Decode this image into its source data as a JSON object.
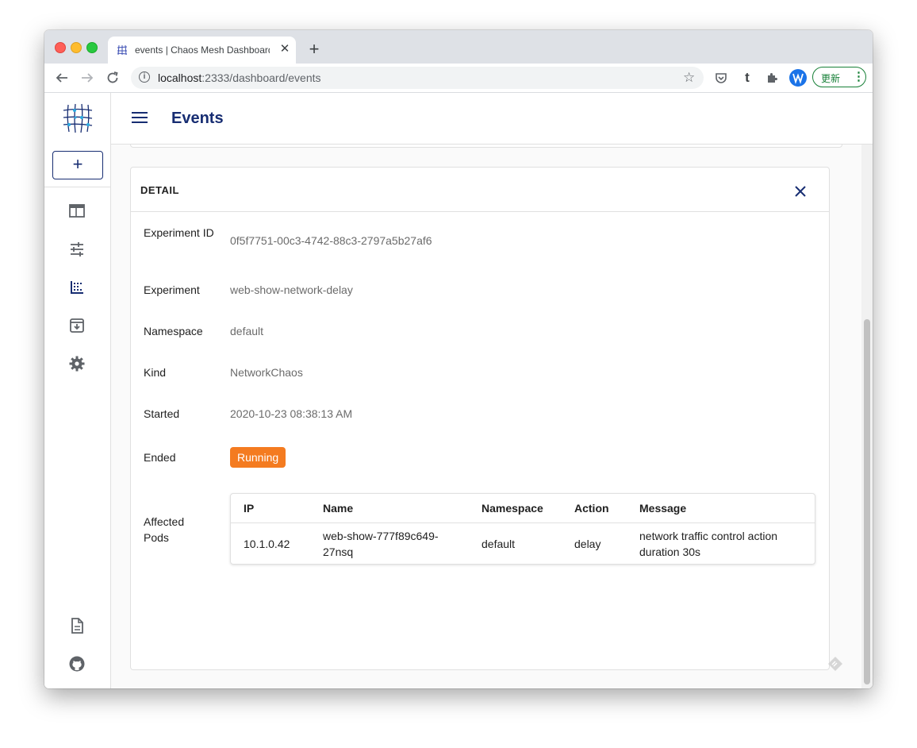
{
  "browser": {
    "tab_title": "events | Chaos Mesh Dashboard",
    "tab_close": "✕",
    "new_tab": "+",
    "url_host": "localhost",
    "url_rest": ":2333/dashboard/events",
    "update_label": "更新",
    "update_menu": "⋮"
  },
  "sidebar": {
    "new_button": "+",
    "items": [
      {
        "icon": "overview-icon"
      },
      {
        "icon": "experiments-icon"
      },
      {
        "icon": "events-icon",
        "active": true
      },
      {
        "icon": "archives-icon"
      },
      {
        "icon": "settings-icon"
      }
    ],
    "bottom_items": [
      {
        "icon": "docs-icon"
      },
      {
        "icon": "github-icon"
      }
    ]
  },
  "header": {
    "title": "Events"
  },
  "detail": {
    "title": "DETAIL",
    "rows": [
      {
        "label": "Experiment ID",
        "value": "0f5f7751-00c3-4742-88c3-2797a5b27af6"
      },
      {
        "label": "Experiment",
        "value": "web-show-network-delay"
      },
      {
        "label": "Namespace",
        "value": "default"
      },
      {
        "label": "Kind",
        "value": "NetworkChaos"
      },
      {
        "label": "Started",
        "value": "2020-10-23 08:38:13 AM"
      },
      {
        "label": "Ended",
        "value": "Running"
      },
      {
        "label": "Affected Pods",
        "value": ""
      }
    ],
    "status_color": "#f47b20",
    "pods": {
      "columns": [
        "IP",
        "Name",
        "Namespace",
        "Action",
        "Message"
      ],
      "rows": [
        {
          "ip": "10.1.0.42",
          "name": "web-show-777f89c649-27nsq",
          "namespace": "default",
          "action": "delay",
          "message": "network traffic control action duration 30s"
        }
      ]
    }
  },
  "colors": {
    "primary": "#172d72",
    "accent": "#f47b20"
  }
}
